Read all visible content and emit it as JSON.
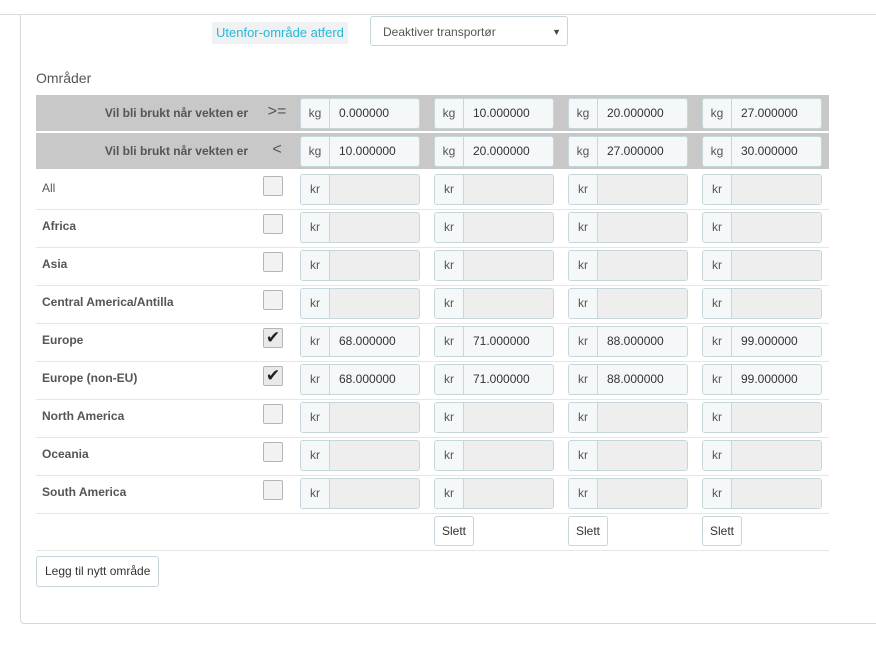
{
  "out_of_range": {
    "label": "Utenfor-område atferd",
    "selected": "Deaktiver transportør"
  },
  "zones_title": "Områder",
  "weight_rows": [
    {
      "label": "Vil bli brukt når vekten er",
      "operator": ">=",
      "unit": "kg",
      "values": [
        "0.000000",
        "10.000000",
        "20.000000",
        "27.000000"
      ]
    },
    {
      "label": "Vil bli brukt når vekten er",
      "operator": "<",
      "unit": "kg",
      "values": [
        "10.000000",
        "20.000000",
        "27.000000",
        "30.000000"
      ]
    }
  ],
  "currency": "kr",
  "zones": [
    {
      "name": "All",
      "checked": false,
      "prices": [
        "",
        "",
        "",
        ""
      ]
    },
    {
      "name": "Africa",
      "checked": false,
      "prices": [
        "",
        "",
        "",
        ""
      ]
    },
    {
      "name": "Asia",
      "checked": false,
      "prices": [
        "",
        "",
        "",
        ""
      ]
    },
    {
      "name": "Central America/Antilla",
      "checked": false,
      "prices": [
        "",
        "",
        "",
        ""
      ]
    },
    {
      "name": "Europe",
      "checked": true,
      "prices": [
        "68.000000",
        "71.000000",
        "88.000000",
        "99.000000"
      ]
    },
    {
      "name": "Europe (non-EU)",
      "checked": true,
      "prices": [
        "68.000000",
        "71.000000",
        "88.000000",
        "99.000000"
      ]
    },
    {
      "name": "North America",
      "checked": false,
      "prices": [
        "",
        "",
        "",
        ""
      ]
    },
    {
      "name": "Oceania",
      "checked": false,
      "prices": [
        "",
        "",
        "",
        ""
      ]
    },
    {
      "name": "South America",
      "checked": false,
      "prices": [
        "",
        "",
        "",
        ""
      ]
    }
  ],
  "delete_label": "Slett",
  "add_zone_label": "Legg til nytt område",
  "icons": {
    "select_caret": "caret-down-icon",
    "checkmark": "checkmark-icon"
  }
}
